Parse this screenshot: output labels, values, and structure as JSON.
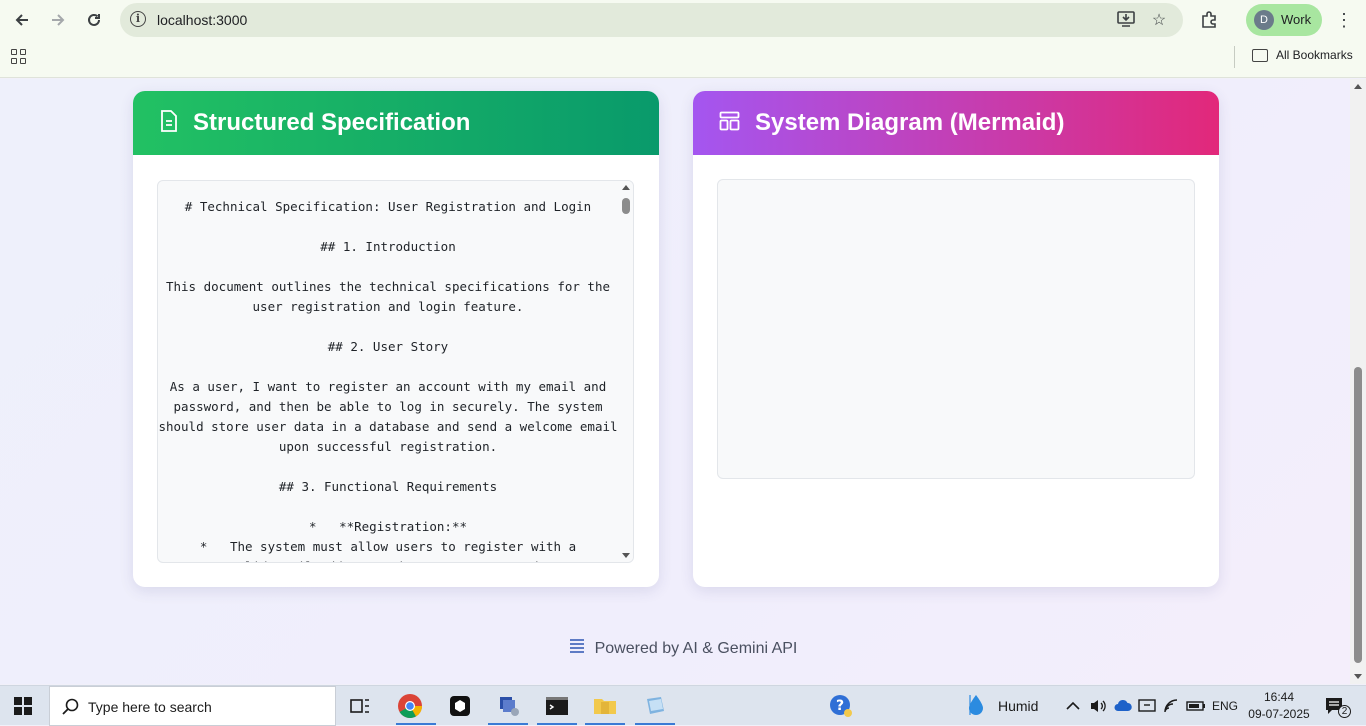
{
  "browser": {
    "url": "localhost:3000",
    "profile_initial": "D",
    "profile_name": "Work",
    "bookmarks_label": "All Bookmarks"
  },
  "spec_card": {
    "title": "Structured Specification",
    "content": "# Technical Specification: User Registration and Login\n\n## 1. Introduction\n\nThis document outlines the technical specifications for the user registration and login feature.\n\n## 2. User Story\n\nAs a user, I want to register an account with my email and password, and then be able to log in securely. The system should store user data in a database and send a welcome email upon successful registration.\n\n## 3. Functional Requirements\n\n*   **Registration:**\n*   The system must allow users to register with a\nvalid email address and a strong password."
  },
  "diagram_card": {
    "title": "System Diagram (Mermaid)"
  },
  "footer": {
    "text": "Powered by AI & Gemini API"
  },
  "taskbar": {
    "search_placeholder": "Type here to search",
    "weather": "Humid",
    "language": "ENG",
    "time": "16:44",
    "date": "09-07-2025",
    "notification_count": "2"
  },
  "colors": {
    "spec_gradient_start": "#22c163",
    "spec_gradient_end": "#099a6b",
    "diagram_gradient_start": "#a456f0",
    "diagram_gradient_end": "#e2287a"
  }
}
